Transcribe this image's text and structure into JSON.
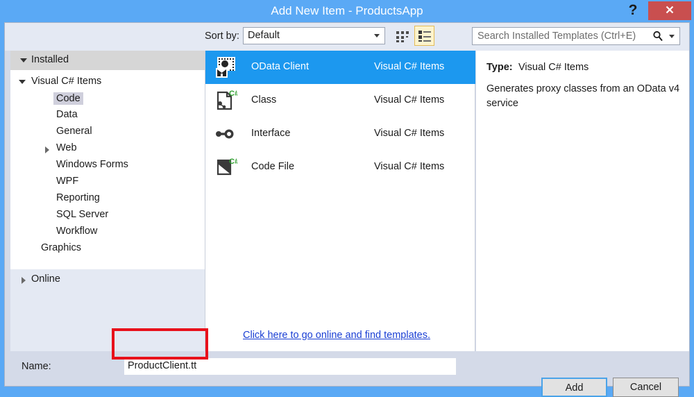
{
  "window": {
    "title": "Add New Item - ProductsApp",
    "help_label": "?",
    "close_label": "✕",
    "titlebar_color": "#5aa9f5",
    "close_color": "#c94f4f"
  },
  "toolbar": {
    "sort_by_label": "Sort by:",
    "sort_by_value": "Default",
    "grid_view_label": "small-icons-view",
    "list_view_label": "list-view",
    "list_view_selected": true
  },
  "search": {
    "placeholder": "Search Installed Templates (Ctrl+E)",
    "icon": "magnifier-icon"
  },
  "sidebar": {
    "installed_header": "Installed",
    "online_header": "Online",
    "group_label": "Visual C# Items",
    "items": [
      {
        "label": "Code",
        "selected": true,
        "expandable": false
      },
      {
        "label": "Data",
        "selected": false,
        "expandable": false
      },
      {
        "label": "General",
        "selected": false,
        "expandable": false
      },
      {
        "label": "Web",
        "selected": false,
        "expandable": true
      },
      {
        "label": "Windows Forms",
        "selected": false,
        "expandable": false
      },
      {
        "label": "WPF",
        "selected": false,
        "expandable": false
      },
      {
        "label": "Reporting",
        "selected": false,
        "expandable": false
      },
      {
        "label": "SQL Server",
        "selected": false,
        "expandable": false
      },
      {
        "label": "Workflow",
        "selected": false,
        "expandable": false
      }
    ],
    "graphics_label": "Graphics"
  },
  "templates": [
    {
      "name": "OData Client",
      "category": "Visual C# Items",
      "icon": "odata-client-icon",
      "selected": true
    },
    {
      "name": "Class",
      "category": "Visual C# Items",
      "icon": "class-icon",
      "selected": false
    },
    {
      "name": "Interface",
      "category": "Visual C# Items",
      "icon": "interface-icon",
      "selected": false
    },
    {
      "name": "Code File",
      "category": "Visual C# Items",
      "icon": "code-file-icon",
      "selected": false
    }
  ],
  "online_link": "Click here to go online and find templates.",
  "details": {
    "type_label": "Type:",
    "type_value": "Visual C# Items",
    "description": "Generates proxy classes from an OData v4 service"
  },
  "name_field": {
    "label": "Name:",
    "value": "ProductClient.tt"
  },
  "buttons": {
    "add": "Add",
    "cancel": "Cancel"
  },
  "annotation": {
    "highlight_color": "#e8111b"
  }
}
